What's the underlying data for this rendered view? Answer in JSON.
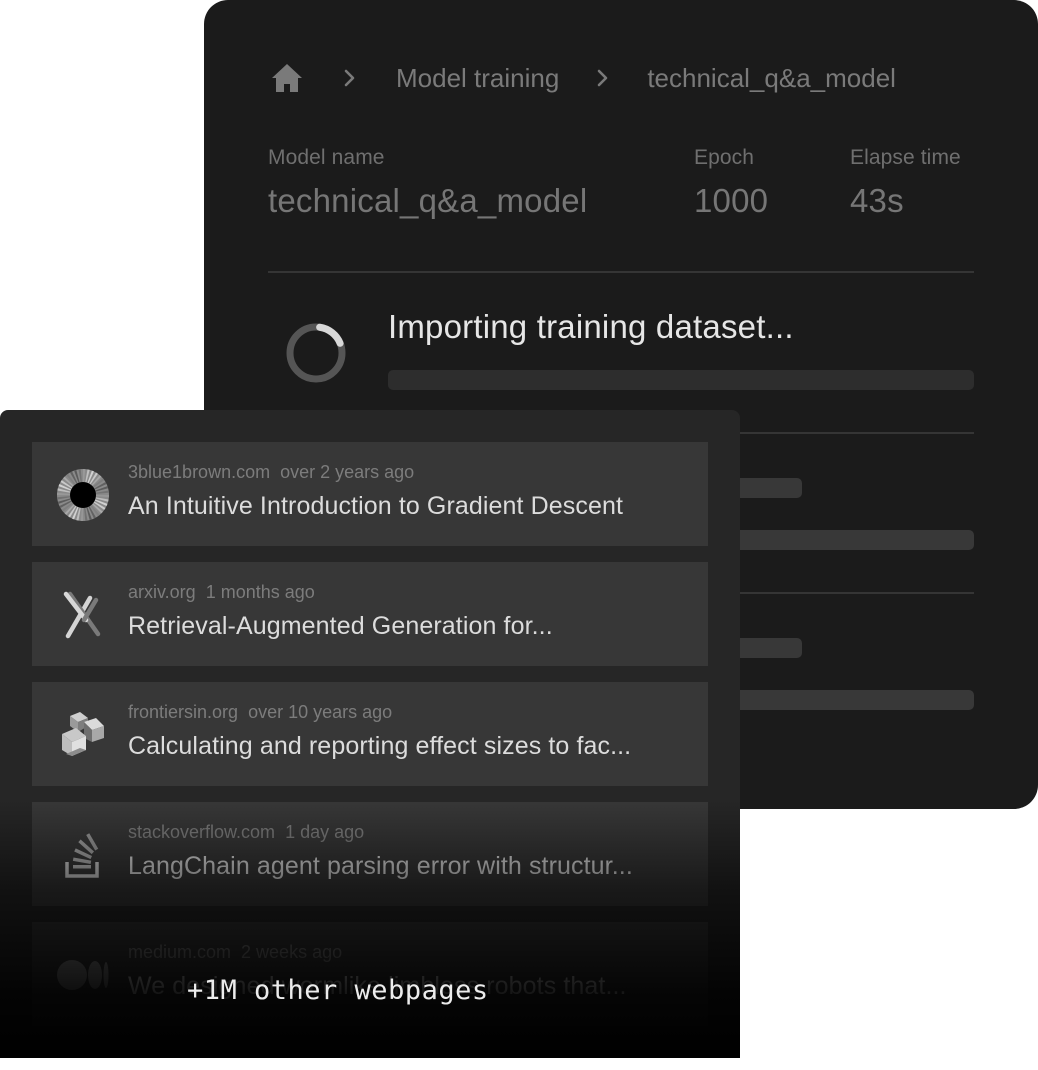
{
  "breadcrumb": {
    "home_icon": "home-icon",
    "separator_icon": "chevron-right-icon",
    "items": [
      "Model training",
      "technical_q&a_model"
    ]
  },
  "model": {
    "name_label": "Model name",
    "name_value": "technical_q&a_model",
    "epoch_label": "Epoch",
    "epoch_value": "1000",
    "elapse_label": "Elapse time",
    "elapse_value": "43s"
  },
  "steps": [
    {
      "title": "Importing training dataset...",
      "status": "in-progress",
      "icon": "spinner-icon"
    },
    {
      "title": "",
      "status": "pending"
    },
    {
      "title": "",
      "status": "pending"
    }
  ],
  "sources": [
    {
      "domain": "3blue1brown.com",
      "age": "over 2 years ago",
      "title": "An Intuitive Introduction to Gradient Descent",
      "icon": "3blue1brown-logo-icon"
    },
    {
      "domain": "arxiv.org",
      "age": "1 months ago",
      "title": "Retrieval-Augmented Generation for...",
      "icon": "arxiv-logo-icon"
    },
    {
      "domain": "frontiersin.org",
      "age": "over 10 years ago",
      "title": "Calculating and reporting effect sizes to fac...",
      "icon": "frontiers-logo-icon"
    },
    {
      "domain": "stackoverflow.com",
      "age": "1 day ago",
      "title": "LangChain agent parsing error with structur...",
      "icon": "stackoverflow-logo-icon"
    },
    {
      "domain": "medium.com",
      "age": "2 weeks ago",
      "title": "We designed wormlike limbless robots that...",
      "icon": "medium-logo-icon"
    }
  ],
  "more_label": "+1M other webpages",
  "colors": {
    "back_panel_bg": "#1b1b1b",
    "front_panel_bg": "#262626",
    "item_bg": "#373737",
    "text_primary": "#dcdcdc",
    "text_muted": "#7a7a7a"
  }
}
